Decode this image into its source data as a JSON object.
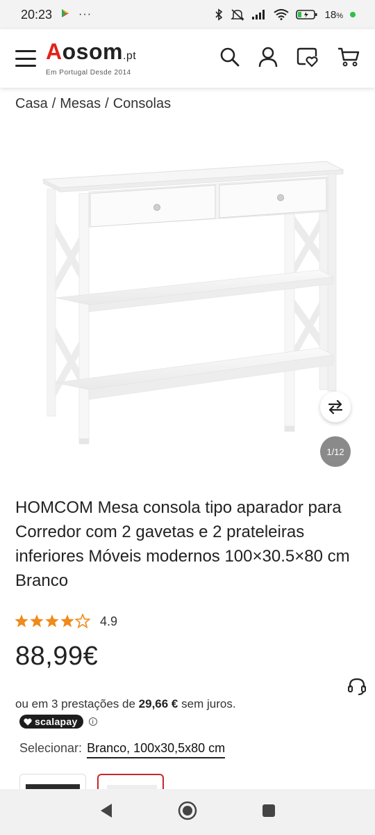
{
  "status_bar": {
    "time": "20:23",
    "more": "···",
    "battery": "18",
    "battery_unit": "%",
    "icons": [
      "play-store-icon",
      "bluetooth-icon",
      "mute-icon",
      "signal-icon",
      "wifi-icon",
      "battery-icon"
    ]
  },
  "header": {
    "logo_first": "A",
    "logo_rest": "osom",
    "logo_suffix": ".pt",
    "tagline": "Em Portugal Desde 2014",
    "icons": [
      "menu-icon",
      "search-icon",
      "account-icon",
      "wishlist-icon",
      "cart-icon"
    ]
  },
  "breadcrumb": {
    "items": [
      "Casa",
      "Mesas",
      "Consolas"
    ],
    "separator": "/"
  },
  "gallery": {
    "counter": "1/12"
  },
  "product": {
    "title": "HOMCOM Mesa consola tipo aparador para Corredor com 2 gavetas e 2 prateleiras inferiores Móveis modernos 100×30.5×80 cm Branco",
    "rating": "4.9",
    "rating_fraction": 0.98,
    "price": "88,99€",
    "installments_prefix": "ou em 3 prestações de ",
    "installments_amount": "29,66 €",
    "installments_suffix": " sem juros.",
    "scalapay_label": "scalapay",
    "select_label": "Selecionar:",
    "select_value": "Branco, 100x30,5x80 cm"
  },
  "colors": {
    "brand_red": "#e2231a",
    "star_orange": "#f08a18",
    "selected_border": "#c62828"
  }
}
